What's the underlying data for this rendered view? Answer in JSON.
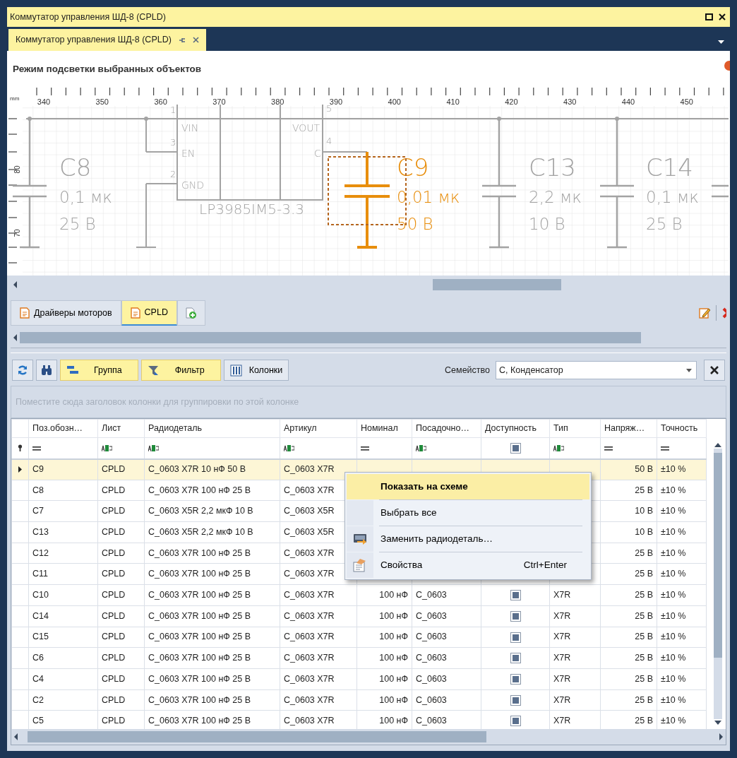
{
  "window": {
    "title": "Коммутатор управления ШД-8 (CPLD)"
  },
  "document_tabs": [
    {
      "label": "Коммутатор управления ШД-8 (CPLD)",
      "selected": true
    }
  ],
  "schematic": {
    "heading": "Режим подсветки выбранных объектов",
    "ruler": {
      "unit": "mm",
      "x_labels": [
        "340",
        "350",
        "360",
        "370",
        "380",
        "390",
        "400",
        "410",
        "420",
        "430",
        "440",
        "450"
      ],
      "y_labels": [
        "80",
        "70"
      ]
    },
    "ic": {
      "name": "LP3985IM5-3.3",
      "pins": [
        {
          "number": "1",
          "name": "VIN"
        },
        {
          "number": "3",
          "name": "EN"
        },
        {
          "number": "2",
          "name": "GND"
        },
        {
          "number": "5",
          "name": "VOUT"
        },
        {
          "number": "4",
          "name": "C"
        }
      ]
    },
    "capacitors": [
      {
        "ref": "C8",
        "value": "0,1 мк",
        "voltage": "25 В",
        "selected": false
      },
      {
        "ref": "C9",
        "value": "0,01 мк",
        "voltage": "50 В",
        "selected": true
      },
      {
        "ref": "C13",
        "value": "2,2 мк",
        "voltage": "10 В",
        "selected": false
      },
      {
        "ref": "C14",
        "value": "0,1 мк",
        "voltage": "25 В",
        "selected": false
      }
    ]
  },
  "sheet_tabs": [
    {
      "label": "Драйверы моторов",
      "selected": false
    },
    {
      "label": "CPLD",
      "selected": true
    }
  ],
  "toolbar": {
    "buttons": [
      {
        "label": "Группа",
        "pressed": true
      },
      {
        "label": "Фильтр",
        "pressed": true
      },
      {
        "label": "Колонки",
        "pressed": false
      }
    ],
    "family": {
      "label": "Семейство",
      "value": "С, Конденсатор"
    }
  },
  "group_panel": {
    "placeholder": "Поместите сюда заголовок колонки для группировки по этой колонке"
  },
  "table": {
    "columns": [
      {
        "title": "Поз.обозн…",
        "kind": "equals"
      },
      {
        "title": "Лист",
        "kind": "abc"
      },
      {
        "title": "Радиодеталь",
        "kind": "abc"
      },
      {
        "title": "Артикул",
        "kind": "abc"
      },
      {
        "title": "Номинал",
        "kind": "equals"
      },
      {
        "title": "Посадочно…",
        "kind": "abc"
      },
      {
        "title": "Доступность",
        "kind": "check",
        "checked": true
      },
      {
        "title": "Тип",
        "kind": "abc"
      },
      {
        "title": "Напряж…",
        "kind": "equals"
      },
      {
        "title": "Точность",
        "kind": "equals"
      }
    ],
    "rows": [
      {
        "selected": true,
        "cells": [
          "C9",
          "CPLD",
          "C_0603 X7R 10 нФ 50 В",
          "C_0603 X7R",
          null,
          null,
          null,
          null,
          "50 В",
          "±10 %"
        ]
      },
      {
        "selected": false,
        "cells": [
          "C8",
          "CPLD",
          "C_0603 X7R 100 нФ 25 В",
          "C_0603 X7R",
          null,
          null,
          null,
          null,
          "25 В",
          "±10 %"
        ]
      },
      {
        "selected": false,
        "cells": [
          "C7",
          "CPLD",
          "C_0603 X5R 2,2 мкФ 10 В",
          "C_0603 X5R",
          null,
          null,
          null,
          null,
          "10 В",
          "±10 %"
        ]
      },
      {
        "selected": false,
        "cells": [
          "C13",
          "CPLD",
          "C_0603 X5R 2,2 мкФ 10 В",
          "C_0603 X5R",
          null,
          null,
          null,
          null,
          "10 В",
          "±10 %"
        ]
      },
      {
        "selected": false,
        "cells": [
          "C12",
          "CPLD",
          "C_0603 X7R 100 нФ 25 В",
          "C_0603 X7R",
          null,
          null,
          null,
          null,
          "25 В",
          "±10 %"
        ]
      },
      {
        "selected": false,
        "cells": [
          "C11",
          "CPLD",
          "C_0603 X7R 100 нФ 25 В",
          "C_0603 X7R",
          null,
          null,
          null,
          null,
          "25 В",
          "±10 %"
        ]
      },
      {
        "selected": false,
        "available": true,
        "cells": [
          "C10",
          "CPLD",
          "C_0603 X7R 100 нФ 25 В",
          "C_0603 X7R",
          "100 нФ",
          "C_0603",
          null,
          "X7R",
          "25 В",
          "±10 %"
        ]
      },
      {
        "selected": false,
        "available": true,
        "cells": [
          "C14",
          "CPLD",
          "C_0603 X7R 100 нФ 25 В",
          "C_0603 X7R",
          "100 нФ",
          "C_0603",
          null,
          "X7R",
          "25 В",
          "±10 %"
        ]
      },
      {
        "selected": false,
        "available": true,
        "cells": [
          "C15",
          "CPLD",
          "C_0603 X7R 100 нФ 25 В",
          "C_0603 X7R",
          "100 нФ",
          "C_0603",
          null,
          "X7R",
          "25 В",
          "±10 %"
        ]
      },
      {
        "selected": false,
        "available": true,
        "cells": [
          "C6",
          "CPLD",
          "C_0603 X7R 100 нФ 25 В",
          "C_0603 X7R",
          "100 нФ",
          "C_0603",
          null,
          "X7R",
          "25 В",
          "±10 %"
        ]
      },
      {
        "selected": false,
        "available": true,
        "cells": [
          "C4",
          "CPLD",
          "C_0603 X7R 100 нФ 25 В",
          "C_0603 X7R",
          "100 нФ",
          "C_0603",
          null,
          "X7R",
          "25 В",
          "±10 %"
        ]
      },
      {
        "selected": false,
        "available": true,
        "cells": [
          "C2",
          "CPLD",
          "C_0603 X7R 100 нФ 25 В",
          "C_0603 X7R",
          "100 нФ",
          "C_0603",
          null,
          "X7R",
          "25 В",
          "±10 %"
        ]
      },
      {
        "selected": false,
        "available": true,
        "cells": [
          "C5",
          "CPLD",
          "C_0603 X7R 100 нФ 25 В",
          "C_0603 X7R",
          "100 нФ",
          "C_0603",
          null,
          "X7R",
          "25 В",
          "±10 %"
        ]
      }
    ]
  },
  "context_menu": {
    "items": [
      {
        "label": "Показать на схеме",
        "highlighted": true,
        "default": true
      },
      {
        "label": "Выбрать все",
        "highlighted": false,
        "default": false
      },
      {
        "label": "Заменить радиодеталь…",
        "highlighted": false,
        "default": false
      },
      {
        "label": "Свойства",
        "shortcut": "Ctrl+Enter",
        "highlighted": false,
        "default": false
      }
    ]
  }
}
